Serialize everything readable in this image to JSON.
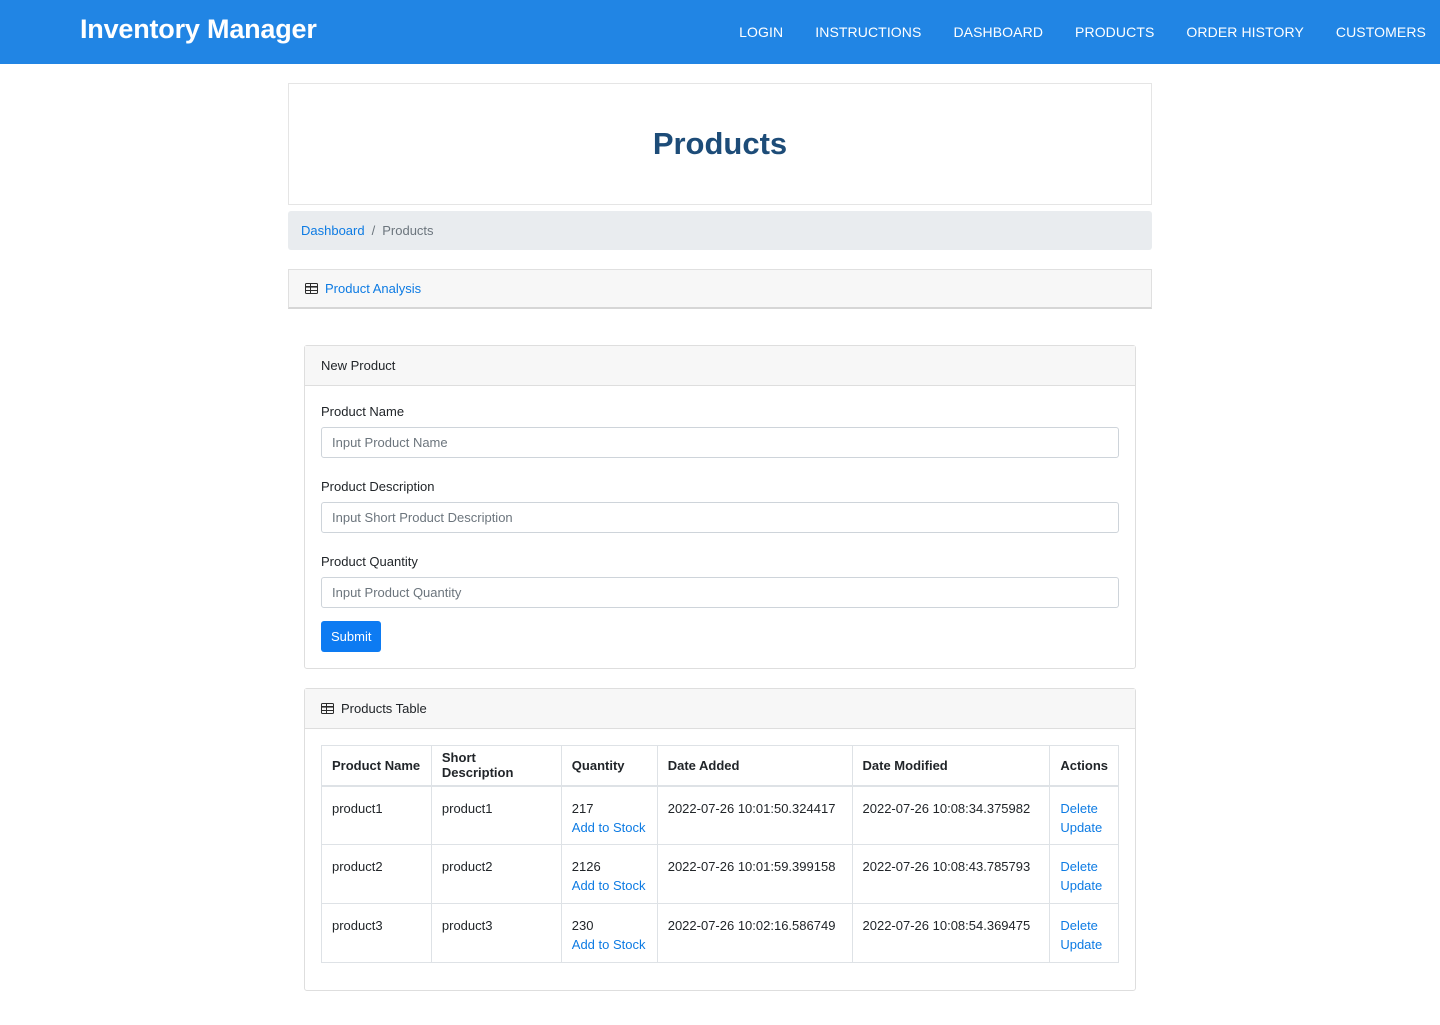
{
  "navbar": {
    "brand": "Inventory Manager",
    "links": [
      "LOGIN",
      "INSTRUCTIONS",
      "DASHBOARD",
      "PRODUCTS",
      "ORDER HISTORY",
      "CUSTOMERS"
    ]
  },
  "page": {
    "title": "Products"
  },
  "breadcrumb": {
    "parent": "Dashboard",
    "separator": "/",
    "current": "Products"
  },
  "analysis": {
    "label": "Product Analysis",
    "icon": "table-icon"
  },
  "new_product": {
    "header": "New Product",
    "name_label": "Product Name",
    "name_placeholder": "Input Product Name",
    "description_label": "Product Description",
    "description_placeholder": "Input Short Product Description",
    "quantity_label": "Product Quantity",
    "quantity_placeholder": "Input Product Quantity",
    "submit_label": "Submit"
  },
  "products_table": {
    "header": "Products Table",
    "icon": "table-icon",
    "columns": [
      "Product Name",
      "Short Description",
      "Quantity",
      "Date Added",
      "Date Modified",
      "Actions"
    ],
    "add_stock_label": "Add to Stock",
    "delete_label": "Delete",
    "update_label": "Update",
    "rows": [
      {
        "name": "product1",
        "description": "product1",
        "quantity": "217",
        "date_added": "2022-07-26 10:01:50.324417",
        "date_modified": "2022-07-26 10:08:34.375982"
      },
      {
        "name": "product2",
        "description": "product2",
        "quantity": "2126",
        "date_added": "2022-07-26 10:01:59.399158",
        "date_modified": "2022-07-26 10:08:43.785793"
      },
      {
        "name": "product3",
        "description": "product3",
        "quantity": "230",
        "date_added": "2022-07-26 10:02:16.586749",
        "date_modified": "2022-07-26 10:08:54.369475"
      }
    ]
  },
  "colors": {
    "navbar": "#2185e4",
    "title": "#1d4c78",
    "link": "#0d7be3",
    "primary_button": "#0d7bf2"
  }
}
